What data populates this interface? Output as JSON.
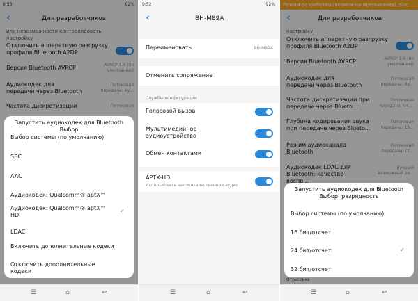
{
  "p1": {
    "status_time": "9:53",
    "status_right": "92%",
    "title": "Для разработчиков",
    "rows": [
      {
        "label": "или невозможности контролировать настройку",
        "value": ""
      },
      {
        "label": "Отключить аппаратную разгрузку профиля Bluetooth A2DP",
        "value": ""
      },
      {
        "label": "Версия Bluetooth AVRCP",
        "value": "AVRCP 1.4 (по умолчанию)"
      },
      {
        "label": "Аудиокодек для передачи через Bluetooth",
        "value": "Потоковая передача: Ау..."
      },
      {
        "label": "Частота дискретизации",
        "value": "Потоковая"
      }
    ],
    "dialog": {
      "title": "Запустить аудиокодек для Bluetooth Выбор",
      "options": [
        "Выбор системы (по умолчанию)",
        "SBC",
        "AAC",
        "Аудиокодек: Qualcomm® aptX™",
        "Аудиокодек: Qualcomm® aptX™ HD",
        "LDAC",
        "Включить дополнительные кодеки",
        "Отключить дополнительные кодеки"
      ],
      "check": "✓"
    }
  },
  "p2": {
    "status_time": "9:52",
    "status_right": "92%",
    "title": "BH-M89A",
    "rename_label": "Переименовать",
    "rename_value": "BH-M89A",
    "unpair_label": "Отменить сопряжение",
    "section": "Службы конфигурации",
    "services": [
      "Голосовой вызов",
      "Мультимедийное аудиоустройство",
      "Обмен контактами"
    ],
    "aptx_label": "APTX-HD",
    "aptx_sub": "Использовать высококачественное аудио"
  },
  "p3": {
    "banner": "Режим разработки (возможны прерывания). Кос",
    "title": "Для разработчиков",
    "rows": [
      {
        "label": "настройку",
        "value": ""
      },
      {
        "label": "Отключить аппаратную разгрузку профиля Bluetooth A2DP",
        "value": ""
      },
      {
        "label": "Версия Bluetooth AVRCP",
        "value": "AVRCP 1.4 (по умолчанию)"
      },
      {
        "label": "Аудиокодек для передачи через Bluetooth",
        "value": "Потоковая передача: Ау..."
      },
      {
        "label": "Частота дискретизации при передаче через Blueto...",
        "value": "Потоковая передача: 44,..."
      },
      {
        "label": "Глубина кодирования звука при передаче через Blueto...",
        "value": "Потоковая передача: 16..."
      },
      {
        "label": "Режим аудиоканала Bluetooth",
        "value": "Потоковая передача: ст..."
      },
      {
        "label": "Аудиокодек LDAC для Bluetooth: качество воспр...",
        "value": "Лучший возможный ре..."
      }
    ],
    "dialog": {
      "title": "Запустить аудиокодек для Bluetooth Выбор: разрядность",
      "options": [
        "Выбор системы (по умолчанию)",
        "16 бит/отсчет",
        "24 бит/отсчет",
        "32 бит/отсчет"
      ],
      "check": "✓"
    },
    "bottom_label": "Отрисовка"
  },
  "nav": {
    "menu": "☰",
    "home": "⌂",
    "back": "↩"
  }
}
